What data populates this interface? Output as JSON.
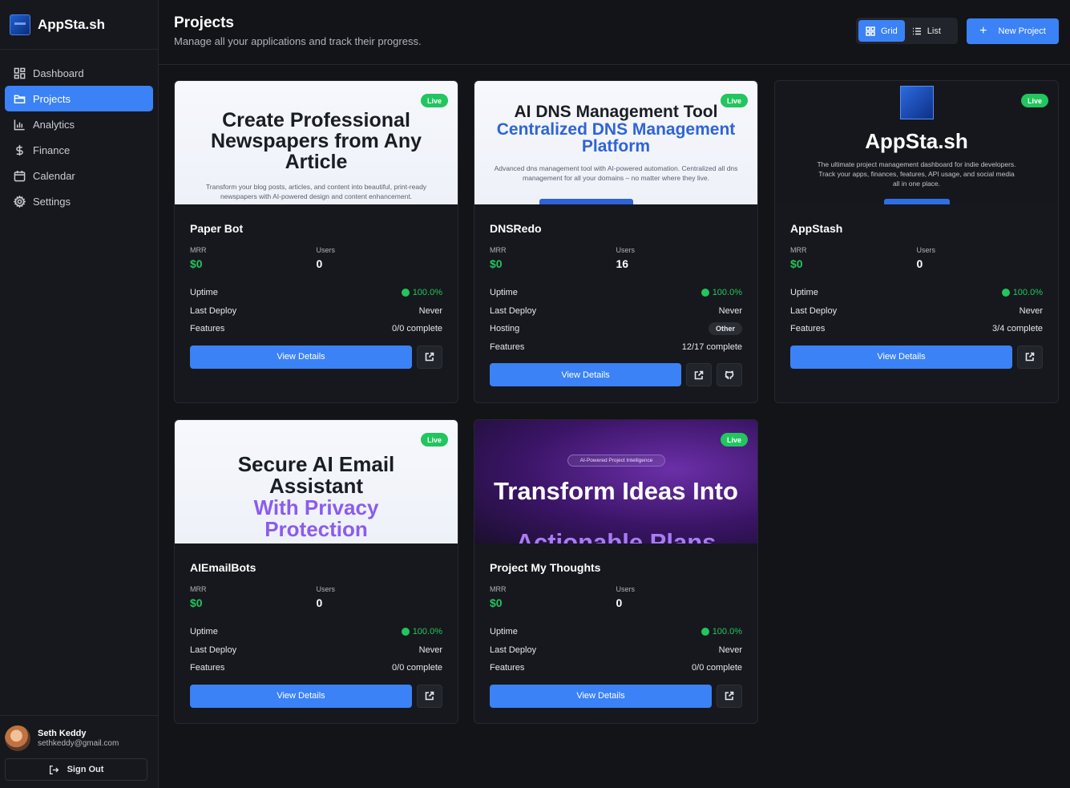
{
  "app": {
    "name": "AppSta.sh"
  },
  "sidebar": {
    "items": [
      {
        "label": "Dashboard",
        "icon": "dashboard-icon"
      },
      {
        "label": "Projects",
        "icon": "folder-icon",
        "active": true
      },
      {
        "label": "Analytics",
        "icon": "chart-icon"
      },
      {
        "label": "Finance",
        "icon": "dollar-icon"
      },
      {
        "label": "Calendar",
        "icon": "calendar-icon"
      },
      {
        "label": "Settings",
        "icon": "gear-icon"
      }
    ]
  },
  "user": {
    "name": "Seth Keddy",
    "email": "sethkeddy@gmail.com",
    "signout_label": "Sign Out"
  },
  "header": {
    "title": "Projects",
    "subtitle": "Manage all your applications and track their progress.",
    "view_grid": "Grid",
    "view_list": "List",
    "new_project": "New Project"
  },
  "labels": {
    "mrr": "MRR",
    "users": "Users",
    "uptime": "Uptime",
    "last_deploy": "Last Deploy",
    "features": "Features",
    "hosting": "Hosting",
    "view_details": "View Details",
    "live": "Live"
  },
  "projects": [
    {
      "name": "Paper Bot",
      "mrr": "$0",
      "users": "0",
      "uptime": "100.0%",
      "last_deploy": "Never",
      "features": "0/0 complete",
      "thumb": {
        "heading": "Create Professional Newspapers from Any Article",
        "text": "Transform your blog posts, articles, and content into beautiful, print-ready newspapers with AI-powered design and content enhancement."
      }
    },
    {
      "name": "DNSRedo",
      "mrr": "$0",
      "users": "16",
      "uptime": "100.0%",
      "last_deploy": "Never",
      "hosting": "Other",
      "features": "12/17 complete",
      "thumb": {
        "heading": "AI DNS Management Tool",
        "heading2": "Centralized DNS Management Platform",
        "text": "Advanced dns management tool with AI-powered automation. Centralized all dns management for all your domains – no matter where they live."
      }
    },
    {
      "name": "AppStash",
      "mrr": "$0",
      "users": "0",
      "uptime": "100.0%",
      "last_deploy": "Never",
      "features": "3/4 complete",
      "thumb": {
        "heading": "AppSta.sh",
        "text": "The ultimate project management dashboard for indie developers. Track your apps, finances, features, API usage, and social media all in one place."
      }
    },
    {
      "name": "AIEmailBots",
      "mrr": "$0",
      "users": "0",
      "uptime": "100.0%",
      "last_deploy": "Never",
      "features": "0/0 complete",
      "thumb": {
        "heading": "Secure AI Email Assistant",
        "heading2": "With Privacy Protection"
      }
    },
    {
      "name": "Project My Thoughts",
      "mrr": "$0",
      "users": "0",
      "uptime": "100.0%",
      "last_deploy": "Never",
      "features": "0/0 complete",
      "thumb": {
        "badge": "AI-Powered Project Intelligence",
        "heading": "Transform Ideas Into",
        "heading2": "Actionable Plans"
      }
    }
  ],
  "colors": {
    "accent": "#3b82f6",
    "live": "#22c55e",
    "background": "#131418",
    "sidebar": "#16181d"
  }
}
